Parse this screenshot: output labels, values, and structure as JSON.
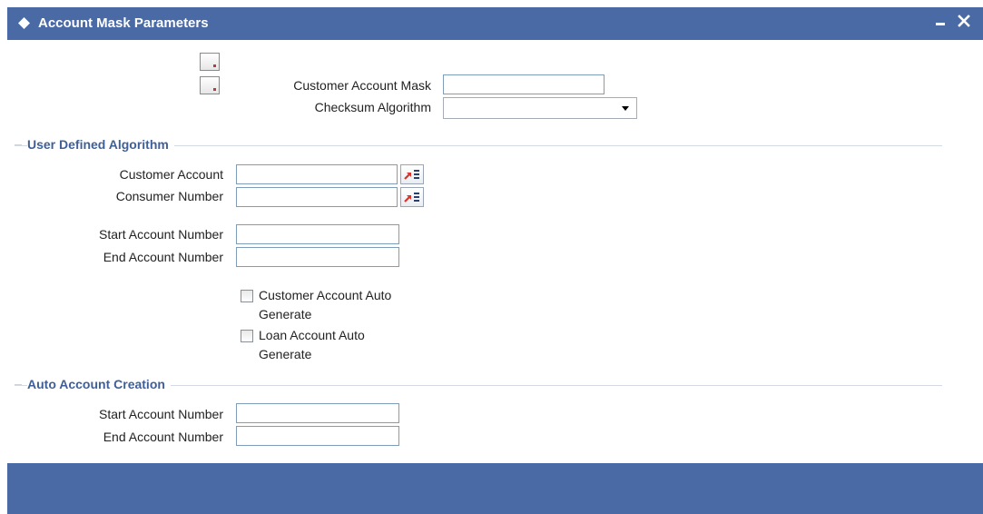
{
  "window": {
    "title": "Account Mask Parameters",
    "minimize_symbol": "–",
    "close_symbol": "✕"
  },
  "top_form": {
    "customer_account_mask": {
      "label": "Customer Account Mask",
      "value": ""
    },
    "checksum_algorithm": {
      "label": "Checksum Algorithm",
      "selected": ""
    }
  },
  "user_defined_algorithm": {
    "title": "User Defined Algorithm",
    "customer_account": {
      "label": "Customer Account",
      "value": ""
    },
    "consumer_number": {
      "label": "Consumer Number",
      "value": ""
    },
    "start_account_number": {
      "label": "Start Account Number",
      "value": ""
    },
    "end_account_number": {
      "label": "End Account Number",
      "value": ""
    },
    "customer_account_auto_generate": {
      "label": "Customer Account Auto Generate",
      "checked": false
    },
    "loan_account_auto_generate": {
      "label": "Loan Account Auto Generate",
      "checked": false
    }
  },
  "auto_account_creation": {
    "title": "Auto Account Creation",
    "start_account_number": {
      "label": "Start Account Number",
      "value": ""
    },
    "end_account_number": {
      "label": "End Account Number",
      "value": ""
    }
  },
  "colors": {
    "title_bar": "#4a6aa5",
    "section_title": "#3f5f99",
    "footer": "#4a6aa5"
  },
  "icons": {
    "title": "diamond-icon",
    "doc": "document-icon",
    "lov": "list-of-values-icon",
    "dropdown": "chevron-down-icon"
  }
}
